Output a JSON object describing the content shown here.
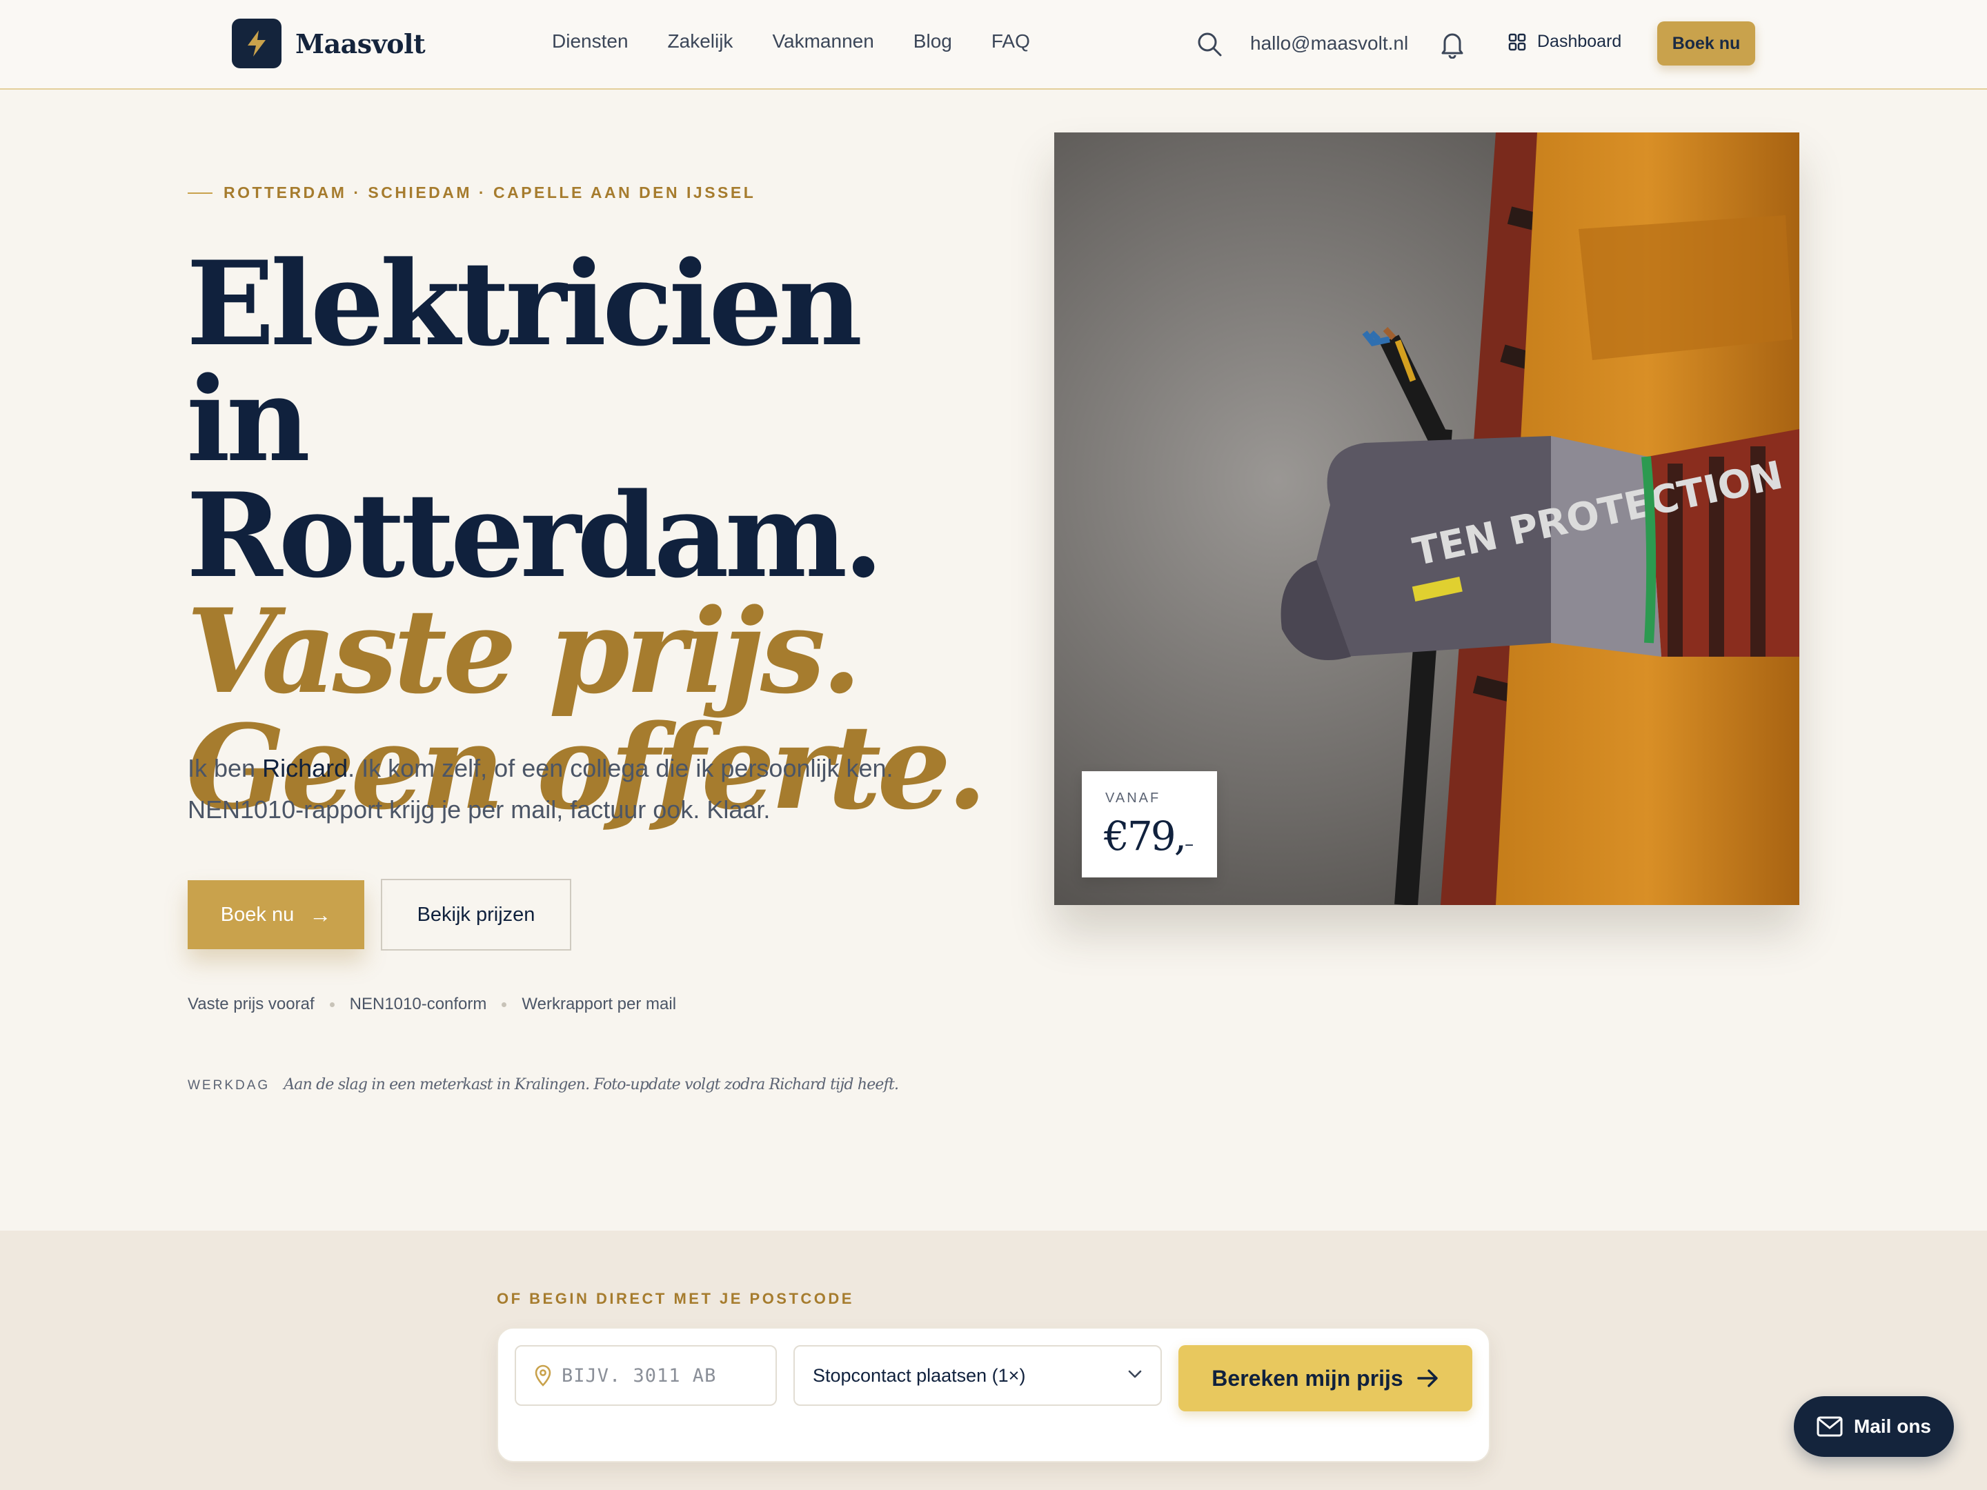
{
  "header": {
    "brand": "Maasvolt",
    "nav": [
      "Diensten",
      "Zakelijk",
      "Vakmannen",
      "Blog",
      "FAQ"
    ],
    "email": "hallo@maasvolt.nl",
    "dashboard_label": "Dashboard",
    "book_label": "Boek nu"
  },
  "hero": {
    "eyebrow": "ROTTERDAM · SCHIEDAM · CAPELLE AAN DEN IJSSEL",
    "title_line1": "Elektricien in",
    "title_line2": "Rotterdam.",
    "title_line3": "Vaste prijs.",
    "title_line4": "Geen offerte.",
    "lead_pre": "Ik ben ",
    "lead_name": "Richard",
    "lead_post": ". Ik kom zelf, of een collega die ik persoonlijk ken. NEN1010-rapport krijg je per mail, factuur ook. Klaar.",
    "primary_cta": "Boek nu",
    "secondary_cta": "Bekijk prijzen",
    "trust": [
      "Vaste prijs vooraf",
      "NEN1010-conform",
      "Werkrapport per mail"
    ],
    "werkdag_tag": "WERKDAG",
    "werkdag_text": "Aan de slag in een meterkast in Kralingen. Foto-update volgt zodra Richard tijd heeft.",
    "price_label": "VANAF",
    "price_value": "€79,",
    "price_suffix": "–",
    "photo_glove_text": "TEN PROTECTION"
  },
  "quick_form": {
    "eyebrow": "OF BEGIN DIRECT MET JE POSTCODE",
    "postcode_placeholder": "BIJV. 3011 AB",
    "service_selected": "Stopcontact plaatsen (1×)",
    "submit_label": "Bereken mijn prijs"
  },
  "fab": {
    "label": "Mail ons"
  },
  "colors": {
    "navy": "#10213d",
    "gold": "#a67c2e",
    "gold_button": "#c9a24c",
    "yellow_button": "#e8c85e",
    "background": "#f8f5ef"
  }
}
